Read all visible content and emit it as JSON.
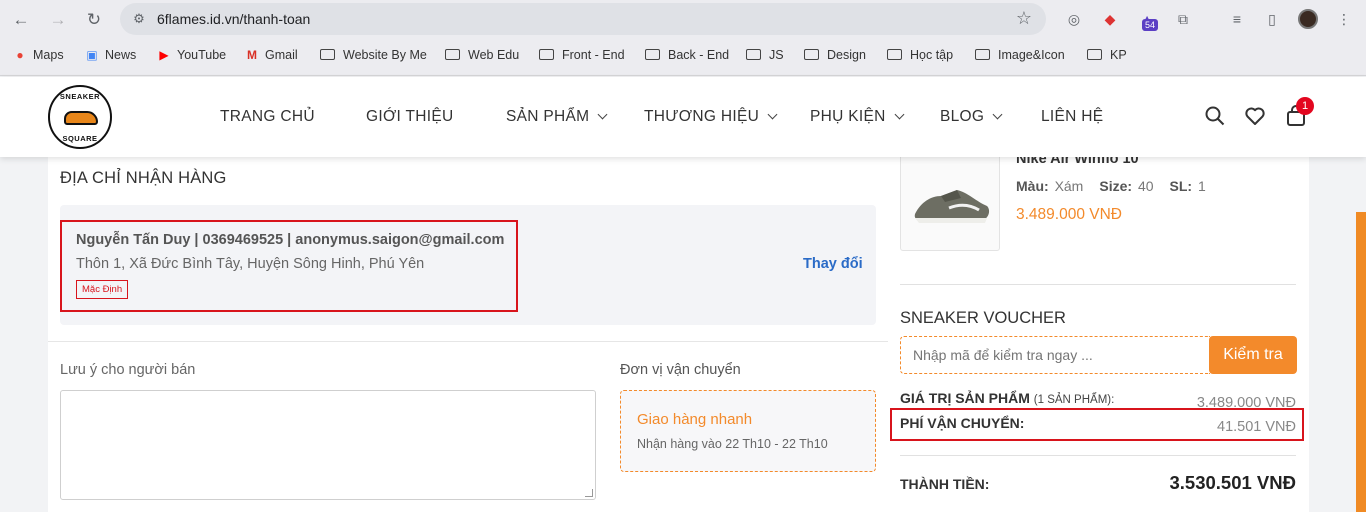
{
  "browser": {
    "url": "6flames.id.vn/thanh-toan",
    "extension_badge": "54"
  },
  "bookmarks": [
    {
      "label": "Maps",
      "icon": "maps-pin-icon"
    },
    {
      "label": "News",
      "icon": "google-news-icon"
    },
    {
      "label": "YouTube",
      "icon": "youtube-icon"
    },
    {
      "label": "Gmail",
      "icon": "gmail-icon"
    },
    {
      "label": "Website By Me",
      "icon": "folder-icon"
    },
    {
      "label": "Web Edu",
      "icon": "folder-icon"
    },
    {
      "label": "Front - End",
      "icon": "folder-icon"
    },
    {
      "label": "Back - End",
      "icon": "folder-icon"
    },
    {
      "label": "JS",
      "icon": "folder-icon"
    },
    {
      "label": "Design",
      "icon": "folder-icon"
    },
    {
      "label": "Học tập",
      "icon": "folder-icon"
    },
    {
      "label": "Image&Icon",
      "icon": "folder-icon"
    },
    {
      "label": "KP",
      "icon": "folder-icon"
    }
  ],
  "site": {
    "logo_top": "SNEAKER",
    "logo_bottom": "SQUARE",
    "menu": [
      {
        "label": "TRANG CHỦ",
        "has_dropdown": false
      },
      {
        "label": "GIỚI THIỆU",
        "has_dropdown": false
      },
      {
        "label": "SẢN PHẨM",
        "has_dropdown": true
      },
      {
        "label": "THƯƠNG HIỆU",
        "has_dropdown": true
      },
      {
        "label": "PHỤ KIỆN",
        "has_dropdown": true
      },
      {
        "label": "BLOG",
        "has_dropdown": true
      },
      {
        "label": "LIÊN HỆ",
        "has_dropdown": false
      }
    ],
    "cart_count": "1"
  },
  "address": {
    "title": "ĐỊA CHỈ NHẬN HÀNG",
    "line1": "Nguyễn Tấn Duy | 0369469525 | anonymus.saigon@gmail.com",
    "line2": "Thôn 1, Xã Đức Bình Tây, Huyện Sông Hinh, Phú Yên",
    "badge": "Mặc Định",
    "change_label": "Thay đổi"
  },
  "note": {
    "label": "Lưu ý cho người bán",
    "value": ""
  },
  "shipping": {
    "label": "Đơn vị vận chuyển",
    "method": "Giao hàng nhanh",
    "eta": "Nhận hàng vào 22 Th10 - 22 Th10"
  },
  "product": {
    "name": "Nike Air Winflo 10",
    "color_label": "Màu:",
    "color": "Xám",
    "size_label": "Size:",
    "size": "40",
    "qty_label": "SL:",
    "qty": "1",
    "price": "3.489.000 VNĐ"
  },
  "voucher": {
    "title": "SNEAKER VOUCHER",
    "placeholder": "Nhập mã để kiểm tra ngay ...",
    "button": "Kiểm tra"
  },
  "summary": {
    "subtotal_label": "GIÁ TRỊ SẢN PHẨM",
    "subtotal_count": "(1 SẢN PHẨM):",
    "subtotal_value": "3.489.000 VNĐ",
    "shipping_label": "PHÍ VẬN CHUYỂN:",
    "shipping_value": "41.501 VNĐ",
    "total_label": "THÀNH TIỀN:",
    "total_value": "3.530.501 VNĐ"
  },
  "colors": {
    "accent": "#f38a2b",
    "highlight": "#d8141c",
    "link": "#2a6bc7"
  }
}
